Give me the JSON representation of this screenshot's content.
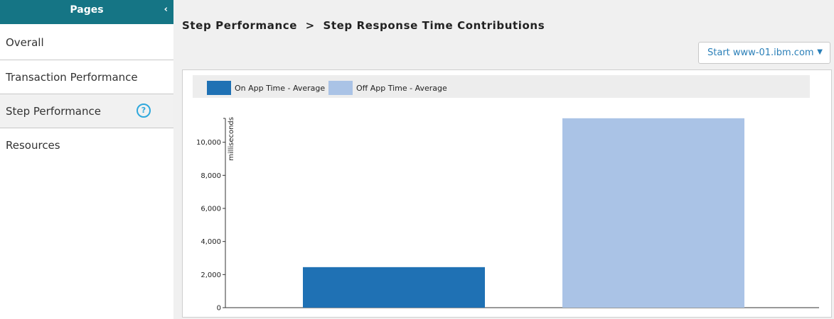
{
  "sidebar": {
    "header": "Pages",
    "collapse_glyph": "‹",
    "items": [
      {
        "label": "Overall"
      },
      {
        "label": "Transaction Performance"
      },
      {
        "label": "Step Performance",
        "active": true,
        "help_glyph": "?"
      },
      {
        "label": "Resources"
      }
    ]
  },
  "breadcrumb": {
    "parent": "Step Performance",
    "separator": ">",
    "current": "Step Response Time Contributions"
  },
  "start_select": {
    "value": "Start www-01.ibm.com",
    "caret": "▼"
  },
  "legend": [
    {
      "label": "On App Time - Average",
      "color": "#1f71b4"
    },
    {
      "label": "Off App Time - Average",
      "color": "#aac3e6"
    }
  ],
  "colors": {
    "sidebar_header": "#157585",
    "accent": "#2a7fb8",
    "help_icon": "#2fa8dc"
  },
  "chart_data": {
    "type": "bar",
    "ylabel": "milliseconds",
    "xlabel": "",
    "categories": [
      "",
      ""
    ],
    "series": [
      {
        "name": "On App Time - Average",
        "values": [
          2450,
          null
        ]
      },
      {
        "name": "Off App Time - Average",
        "values": [
          null,
          11450
        ]
      }
    ],
    "ylim": [
      0,
      12000
    ],
    "yticks": [
      0,
      2000,
      4000,
      6000,
      8000,
      10000
    ],
    "ytick_labels": [
      "0",
      "2,000",
      "4,000",
      "6,000",
      "8,000",
      "10,000"
    ],
    "grid": false,
    "legend_position": "top"
  }
}
